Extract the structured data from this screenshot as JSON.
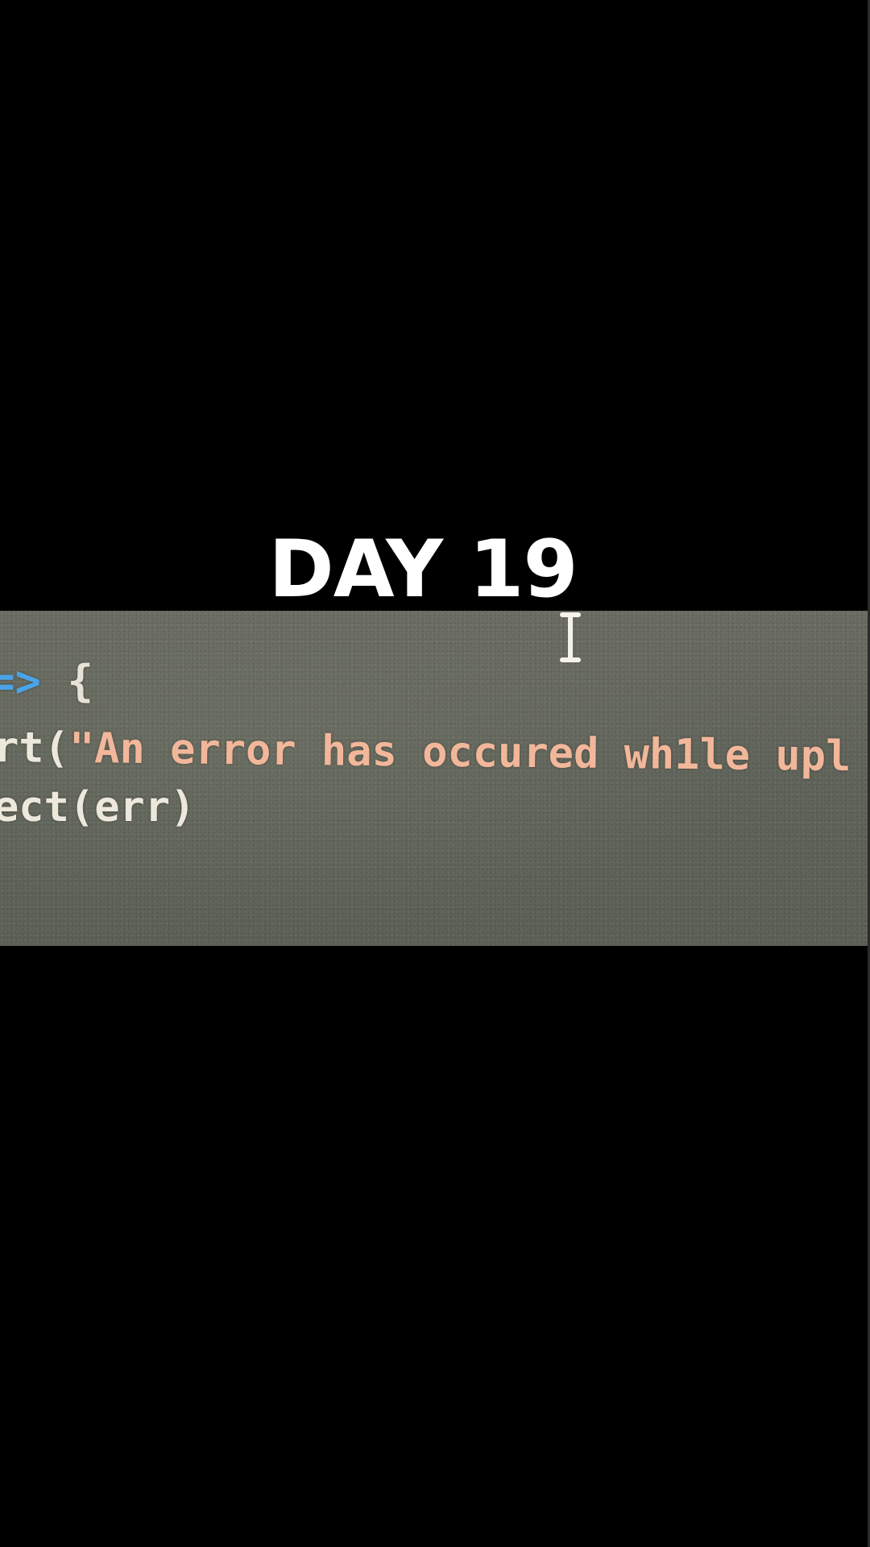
{
  "caption": {
    "text": "DAY 19"
  },
  "photo": {
    "code_lines": [
      {
        "arrow": "=>",
        "brace": "{"
      },
      {
        "prefix": "rt(",
        "string": "\"An error has occured wh1le upl"
      },
      {
        "text": "ect(err)"
      }
    ],
    "colors": {
      "background": "#65685e",
      "arrow": "#4aa3e6",
      "string": "#f2b79a",
      "plain": "#ece8dc"
    },
    "cursor_icon": "text-cursor-icon"
  }
}
